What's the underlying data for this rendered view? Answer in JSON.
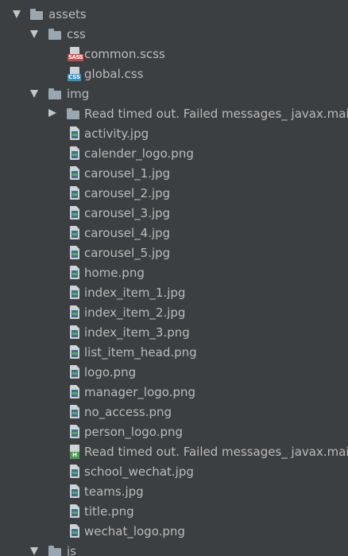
{
  "tree": {
    "assets": {
      "label": "assets",
      "icon": "folder-icon",
      "expanded": true
    },
    "css": {
      "label": "css",
      "icon": "folder-icon",
      "expanded": true,
      "files": [
        {
          "label": "common.scss",
          "icon": "sass-file-icon",
          "badge": "SASS"
        },
        {
          "label": "global.css",
          "icon": "css-file-icon",
          "badge": "CSS"
        }
      ]
    },
    "img": {
      "label": "img",
      "icon": "folder-icon",
      "expanded": true,
      "subfolder": {
        "label": "Read timed out. Failed messages_ javax.mail.M",
        "icon": "folder-icon",
        "expanded": false
      },
      "files": [
        {
          "label": "activity.jpg",
          "icon": "image-file-icon"
        },
        {
          "label": "calender_logo.png",
          "icon": "image-file-icon"
        },
        {
          "label": "carousel_1.jpg",
          "icon": "image-file-icon"
        },
        {
          "label": "carousel_2.jpg",
          "icon": "image-file-icon"
        },
        {
          "label": "carousel_3.jpg",
          "icon": "image-file-icon"
        },
        {
          "label": "carousel_4.jpg",
          "icon": "image-file-icon"
        },
        {
          "label": "carousel_5.jpg",
          "icon": "image-file-icon"
        },
        {
          "label": "home.png",
          "icon": "image-file-icon"
        },
        {
          "label": "index_item_1.jpg",
          "icon": "image-file-icon"
        },
        {
          "label": "index_item_2.jpg",
          "icon": "image-file-icon"
        },
        {
          "label": "index_item_3.png",
          "icon": "image-file-icon"
        },
        {
          "label": "list_item_head.png",
          "icon": "image-file-icon"
        },
        {
          "label": "logo.png",
          "icon": "image-file-icon"
        },
        {
          "label": "manager_logo.png",
          "icon": "image-file-icon"
        },
        {
          "label": "no_access.png",
          "icon": "image-file-icon"
        },
        {
          "label": "person_logo.png",
          "icon": "image-file-icon"
        },
        {
          "label": "Read timed out. Failed messages_ javax.mail.M",
          "icon": "html-file-icon",
          "badge": "H"
        },
        {
          "label": "school_wechat.jpg",
          "icon": "image-file-icon"
        },
        {
          "label": "teams.jpg",
          "icon": "image-file-icon"
        },
        {
          "label": "title.png",
          "icon": "image-file-icon"
        },
        {
          "label": "wechat_logo.png",
          "icon": "image-file-icon"
        }
      ]
    },
    "js": {
      "label": "js",
      "icon": "folder-icon",
      "expanded": true
    }
  },
  "colors": {
    "background": "#3c3f41",
    "text": "#bbbbbb",
    "folder": "#9aa7b0",
    "sass_badge": "#c94a4a",
    "css_badge": "#3592c4",
    "html_badge": "#499c54"
  }
}
